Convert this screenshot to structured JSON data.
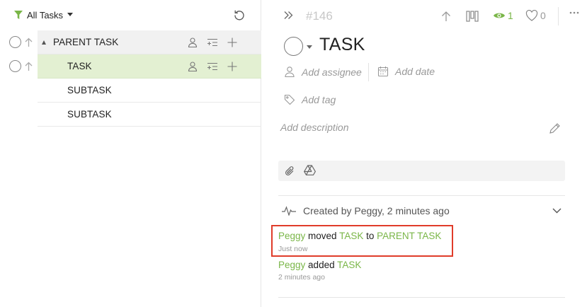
{
  "left_panel": {
    "filter_label": "All Tasks",
    "tasks": [
      {
        "name": "PARENT TASK"
      },
      {
        "name": "TASK"
      },
      {
        "name": "SUBTASK"
      },
      {
        "name": "SUBTASK"
      }
    ]
  },
  "right_panel": {
    "task_number": "#146",
    "watchers_count": "1",
    "likes_count": "0",
    "task_title": "TASK",
    "assignee_placeholder": "Add assignee",
    "date_placeholder": "Add date",
    "tag_placeholder": "Add tag",
    "description_placeholder": "Add description",
    "activity_summary": "Created by Peggy, 2 minutes ago",
    "activity_log": [
      {
        "user": "Peggy",
        "action": "moved",
        "task": "TASK",
        "joiner": "to",
        "target": "PARENT TASK",
        "time": "Just now"
      },
      {
        "user": "Peggy",
        "action": "added",
        "task": "TASK",
        "time": "2 minutes ago"
      }
    ]
  },
  "colors": {
    "accent_green": "#7ab648",
    "selected_row": "#e3f0d2",
    "highlight_border": "#e03c2a"
  },
  "icons": [
    "filter-icon",
    "caret-down-icon",
    "refresh-icon",
    "radio-circle-icon",
    "arrow-up-icon",
    "person-icon",
    "add-subtask-icon",
    "plus-icon",
    "expand-icon",
    "board-icon",
    "eye-icon",
    "heart-icon",
    "more-icon",
    "calendar-icon",
    "tag-icon",
    "pencil-icon",
    "paperclip-icon",
    "drive-icon",
    "activity-icon",
    "chevron-down-icon"
  ]
}
